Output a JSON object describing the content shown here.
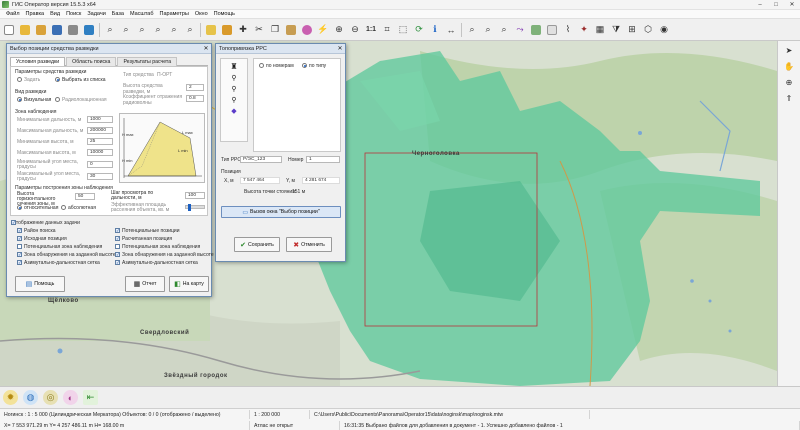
{
  "window": {
    "title": "ГИС Оператор версия 15.5.3 x64",
    "controls": [
      "–",
      "□",
      "✕"
    ]
  },
  "menu": [
    "Файл",
    "Правка",
    "Вид",
    "Поиск",
    "Задачи",
    "База",
    "Масштаб",
    "Параметры",
    "Окно",
    "Помощь"
  ],
  "toolbar": {
    "scale_label": "1:1"
  },
  "map": {
    "labels": {
      "city": "Черноголовка",
      "place1": "Щёлково",
      "place2": "Свердловский",
      "place3": "Звёздный городок"
    },
    "colors": {
      "visibility": "#58c89a",
      "base": "#d7dfcf",
      "forest": "#b9cfa6",
      "water": "#7aa6d6"
    }
  },
  "dialog_position": {
    "title": "Выбор позиции средства разведки",
    "tabs": [
      "Условия разведки",
      "Область поиска",
      "Результаты расчета"
    ],
    "section_params": "Параметры средства разведки",
    "radio_set": "Задать",
    "radio_list": "Выбрать из списка",
    "type_label": "Тип средства",
    "type_value": "П-ОРТ",
    "height_label": "Высота средства разведки, м",
    "height_value": "2",
    "coef_label": "Коэффициент отражения радиоволны",
    "coef_value": "0.8",
    "section_view": "Вид разведки",
    "view_visual": "Визуальная",
    "view_radio": "Радиолокационная",
    "section_zone": "Зона наблюдения",
    "zone_fields": [
      {
        "label": "Минимальная дальность, м",
        "value": "1000"
      },
      {
        "label": "Максимальная дальность, м",
        "value": "200000"
      },
      {
        "label": "Минимальная высота, м",
        "value": "25"
      },
      {
        "label": "Максимальная высота, м",
        "value": "10000"
      },
      {
        "label": "Минимальный угол места, градусы",
        "value": "0"
      },
      {
        "label": "Максимальный угол места, градусы",
        "value": "30"
      }
    ],
    "diagram_hmax": "H max",
    "diagram_hmin": "H min",
    "diagram_lmax": "L max",
    "diagram_lmin": "L min",
    "section_build": "Параметры построения зоны наблюдения",
    "build_height_label": "Высота горизонтального сечения зоны, м",
    "build_height_value": "50",
    "radio_relative": "относительная",
    "radio_absolute": "абсолютная",
    "step_label": "Шаг просмотра по дальности, м",
    "step_value": "100",
    "eff_label": "Эффективная площадь рассеяния объекта, кв. м",
    "display_title": "Отображение данных задачи",
    "display_left": [
      "Район поиска",
      "Исходная позиция",
      "Потенциальная зона наблюдения",
      "Зона обнаружения на заданной высоте",
      "Азимутально-дальностная сетка"
    ],
    "display_right": [
      "Потенциальные позиции",
      "Расчитанная позиция",
      "Потенциальная зона наблюдения",
      "Зона обнаружения на заданной высоте",
      "Азимутально-дальностная сетка"
    ],
    "help_button": "Помощь",
    "report_button": "Отчет",
    "map_button": "На карту"
  },
  "dialog_rrs": {
    "title": "Топопривязка РРС",
    "radio_number": "по номерам",
    "radio_type": "по типу",
    "type_label": "Тип РРС",
    "type_value": "Р/ЭС_123",
    "number_label": "Номер",
    "number_value": "1",
    "position_title": "Позиция",
    "x_label": "X, м",
    "x_value": "7 547 464",
    "y_label": "Y, м",
    "y_value": "4 281 674",
    "mast_label": "Высота точки стояния:",
    "mast_value": "151 м",
    "call_button": "Вызов окна \"Выбор позиции\"",
    "save_button": "Сохранить",
    "cancel_button": "Отменить"
  },
  "status": {
    "row1": [
      "Ногинск : 1 : 5 000 (Цилиндрическая Меркатора) Объектов: 0 / 0 (отображено / выделено)",
      "1 : 200 000",
      "C:\\Users\\Public\\Documents\\Panorama\\Operator15\\data\\noginsk\\map\\noginsk.mtw"
    ],
    "row2": [
      "X= 7 553 971.29 m  Y= 4 257 486.11 m  H= 168.00 m",
      "Атлас не открыт",
      "16:31:35  Выбрано файлов для добавления в документ - 1. Успешно добавлено файлов - 1"
    ]
  }
}
